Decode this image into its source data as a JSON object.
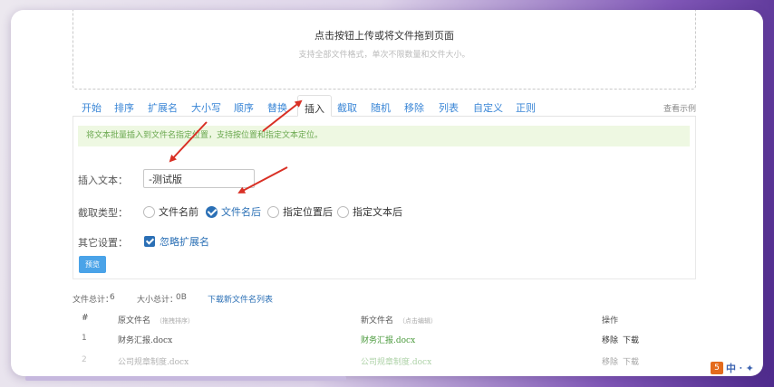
{
  "upload": {
    "title": "点击按钮上传或将文件拖到页面",
    "subtitle": "支持全部文件格式，单次不限数量和文件大小。"
  },
  "tabs": [
    {
      "label": "开始"
    },
    {
      "label": "排序"
    },
    {
      "label": "扩展名"
    },
    {
      "label": "大小写"
    },
    {
      "label": "顺序"
    },
    {
      "label": "替换"
    },
    {
      "label": "插入"
    },
    {
      "label": "截取"
    },
    {
      "label": "随机"
    },
    {
      "label": "移除"
    },
    {
      "label": "列表"
    },
    {
      "label": "自定义"
    },
    {
      "label": "正则"
    }
  ],
  "active_tab": "插入",
  "example_link": "查看示例",
  "tip": "将文本批量插入到文件名指定位置，支持按位置和指定文本定位。",
  "form": {
    "insert_text_label": "插入文本：",
    "insert_text_value": "-测试版",
    "position_type_label": "截取类型：",
    "position_options": [
      {
        "label": "文件名前",
        "checked": false
      },
      {
        "label": "文件名后",
        "checked": true
      },
      {
        "label": "指定位置后",
        "checked": false
      },
      {
        "label": "指定文本后",
        "checked": false
      }
    ],
    "other_settings_label": "其它设置：",
    "ignore_extension_label": "忽略扩展名",
    "ignore_extension_checked": true,
    "preview_button": "预览"
  },
  "stats": {
    "total_files_label": "文件总计：",
    "total_files": "6",
    "total_size_label": "大小总计：",
    "total_size": "0B",
    "download_link": "下载新文件名列表"
  },
  "table": {
    "headers": {
      "index": "#",
      "old_name": "原文件名",
      "old_name_hint": "（拖拽排序）",
      "new_name": "新文件名",
      "new_name_hint": "（点击编辑）",
      "actions": "操作"
    },
    "rows": [
      {
        "index": "1",
        "old_name": "财务汇报.docx",
        "new_name": "财务汇报.docx",
        "remove": "移除",
        "download": "下载"
      },
      {
        "index": "2",
        "old_name": "公司规章制度.docx",
        "new_name": "公司规章制度.docx",
        "remove": "移除",
        "download": "下载"
      }
    ]
  },
  "badge": {
    "icon": "5",
    "text": "中 ⸱ ✦"
  },
  "colors": {
    "accent": "#2a6fb5",
    "tab_link": "#3a86d6",
    "tip_bg": "#eef8e2",
    "arrow": "#d93025",
    "button": "#4aa3e8"
  }
}
